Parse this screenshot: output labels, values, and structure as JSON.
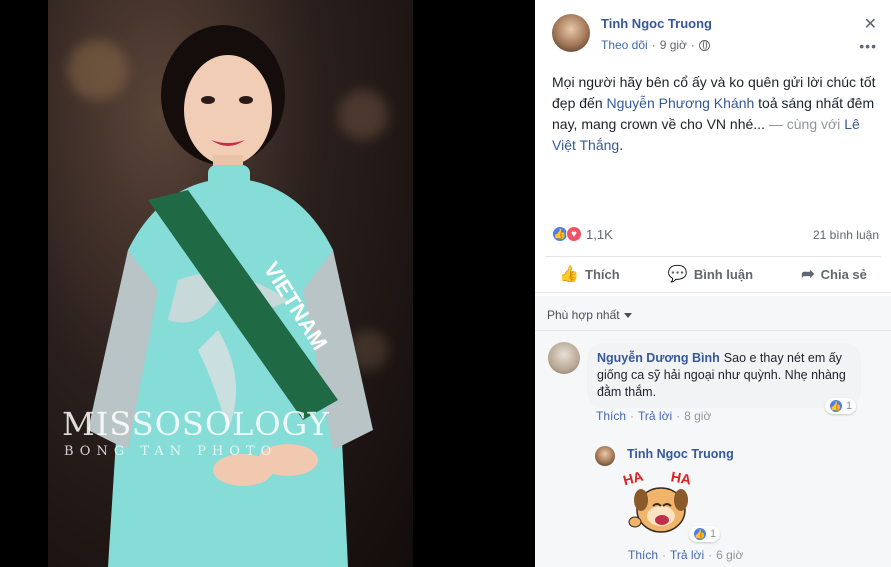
{
  "photo": {
    "watermark": "MISSOSOLOGY",
    "watermark_sub": "BONG TAN PHOTO",
    "sash_text": "VIETNAM"
  },
  "post": {
    "author": "Tinh Ngoc Truong",
    "follow": "Theo dõi",
    "time": "9 giờ",
    "text_part1": "Mọi người hãy bên cổ ấy và ko quên gửi lời chúc tốt đẹp đến ",
    "mention1": "Nguyễn Phương Khánh",
    "text_part2": " toả sáng nhất đêm nay, mang crown về cho VN nhé...",
    "with_text": " — cùng với ",
    "mention2": "Lê Việt Thắng",
    "text_end": ".",
    "reaction_count": "1,1K",
    "comment_count": "21 bình luận",
    "actions": {
      "like": "Thích",
      "comment": "Bình luận",
      "share": "Chia sẻ"
    }
  },
  "comments": {
    "sort_label": "Phù hợp nhất",
    "items": [
      {
        "name": "Nguyễn Dương Bình",
        "text": "Sao e thay nét em ấy giống ca sỹ hải ngoại như quỳnh. Nhẹ nhàng đằm thắm.",
        "like": "Thích",
        "reply": "Trả lời",
        "time": "8 giờ",
        "reactions": "1"
      },
      {
        "name": "Tinh Ngoc Truong",
        "sticker_text_1": "HA",
        "sticker_text_2": "HA",
        "like": "Thích",
        "reply": "Trả lời",
        "time": "6 giờ",
        "reactions": "1"
      }
    ]
  },
  "colors": {
    "link": "#365899",
    "like_blue": "#4a7ff0",
    "love_red": "#f25268",
    "dress": "#7fd6d2"
  }
}
